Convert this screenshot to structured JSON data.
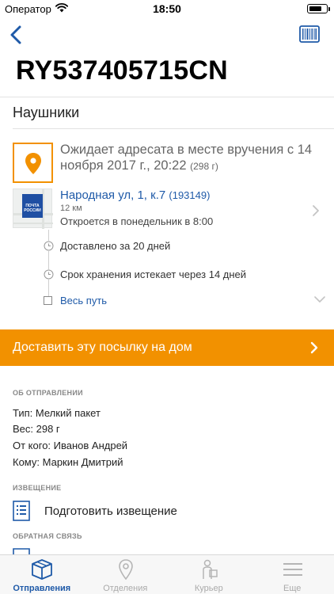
{
  "status_bar": {
    "carrier": "Оператор",
    "time": "18:50"
  },
  "nav": {
    "back_icon": "chevron-left-icon",
    "barcode_icon": "barcode-icon"
  },
  "tracking_number": "RY537405715CN",
  "parcel_name": "Наушники",
  "status": {
    "text": "Ожидает адресата в месте вручения с 14 ноября 2017 г., 20:22",
    "weight": "(298 г)",
    "icon": "location-pin-icon"
  },
  "office": {
    "logo_text": "ПОЧТА РОССИИ",
    "address": "Народная ул, 1, к.7",
    "index": "(193149)",
    "distance": "12 км",
    "hours": "Откроется в понедельник в 8:00"
  },
  "timeline": {
    "delivered_in": "Доставлено за 20 дней",
    "storage_expires": "Срок хранения истекает через 14 дней",
    "all_route": "Весь путь"
  },
  "delivery_banner": {
    "label": "Доставить эту посылку на дом"
  },
  "shipment_info": {
    "header": "ОБ ОТПРАВЛЕНИИ",
    "type": "Тип: Мелкий пакет",
    "weight": "Вес: 298 г",
    "from": "От кого: Иванов Андрей",
    "to": "Кому: Маркин Дмитрий"
  },
  "notice": {
    "header": "ИЗВЕЩЕНИЕ",
    "action": "Подготовить извещение"
  },
  "feedback": {
    "header": "ОБРАТНАЯ СВЯЗЬ"
  },
  "tabs": [
    {
      "label": "Отправления",
      "icon": "box-icon",
      "active": true
    },
    {
      "label": "Отделения",
      "icon": "map-pin-icon",
      "active": false
    },
    {
      "label": "Курьер",
      "icon": "courier-icon",
      "active": false
    },
    {
      "label": "Еще",
      "icon": "menu-icon",
      "active": false
    }
  ],
  "colors": {
    "accent_orange": "#f29100",
    "link_blue": "#1f5aa8",
    "brand_blue": "#1f4fa3"
  }
}
